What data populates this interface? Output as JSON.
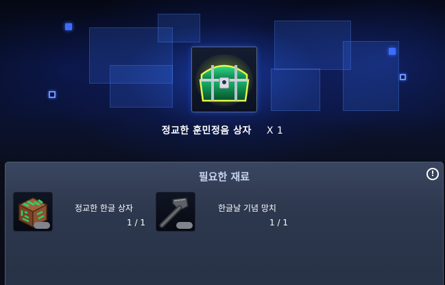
{
  "reward": {
    "name": "정교한 훈민정음 상자",
    "quantity": "X 1",
    "icon": "green-treasure-chest-icon"
  },
  "materials_panel": {
    "title": "필요한 재료",
    "info_symbol": "!",
    "items": [
      {
        "name": "정교한 한글 상자",
        "count": "1 / 1",
        "icon": "wooden-crate-icon"
      },
      {
        "name": "한글날 기념 망치",
        "count": "1 / 1",
        "icon": "hammer-icon"
      }
    ]
  },
  "colors": {
    "panel_bg": "#2d374d",
    "accent_blue": "#3d6cff",
    "title_text": "#c7d3ef"
  }
}
